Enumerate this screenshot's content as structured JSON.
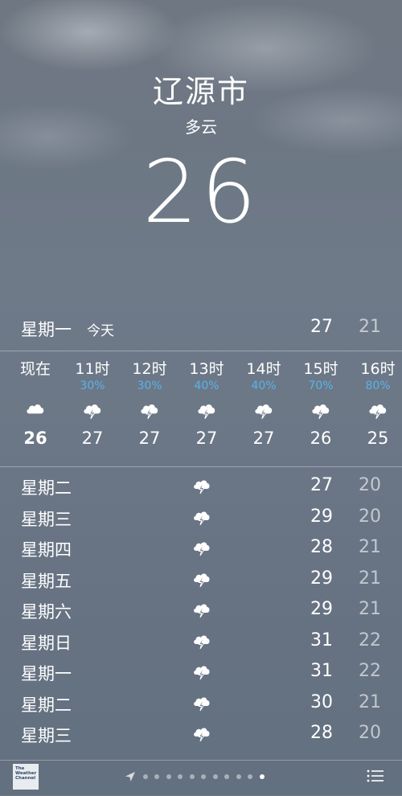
{
  "header": {
    "city": "辽源市",
    "condition": "多云",
    "temperature": "26"
  },
  "today": {
    "day": "星期一",
    "tag": "今天",
    "high": "27",
    "low": "21"
  },
  "hourly": [
    {
      "label": "现在",
      "pop": "",
      "icon": "cloud-icon",
      "temp": "26"
    },
    {
      "label": "11时",
      "pop": "30%",
      "icon": "thunderstorm-icon",
      "temp": "27"
    },
    {
      "label": "12时",
      "pop": "30%",
      "icon": "thunderstorm-icon",
      "temp": "27"
    },
    {
      "label": "13时",
      "pop": "40%",
      "icon": "thunderstorm-icon",
      "temp": "27"
    },
    {
      "label": "14时",
      "pop": "40%",
      "icon": "thunderstorm-icon",
      "temp": "27"
    },
    {
      "label": "15时",
      "pop": "70%",
      "icon": "thunderstorm-icon",
      "temp": "26"
    },
    {
      "label": "16时",
      "pop": "80%",
      "icon": "thunderstorm-icon",
      "temp": "25"
    }
  ],
  "daily": [
    {
      "day": "星期二",
      "icon": "thunderstorm-icon",
      "high": "27",
      "low": "20"
    },
    {
      "day": "星期三",
      "icon": "thunderstorm-icon",
      "high": "29",
      "low": "20"
    },
    {
      "day": "星期四",
      "icon": "thunderstorm-icon",
      "high": "28",
      "low": "21"
    },
    {
      "day": "星期五",
      "icon": "thunderstorm-icon",
      "high": "29",
      "low": "21"
    },
    {
      "day": "星期六",
      "icon": "thunderstorm-icon",
      "high": "29",
      "low": "21"
    },
    {
      "day": "星期日",
      "icon": "thunderstorm-icon",
      "high": "31",
      "low": "22"
    },
    {
      "day": "星期一",
      "icon": "thunderstorm-icon",
      "high": "31",
      "low": "22"
    },
    {
      "day": "星期二",
      "icon": "thunderstorm-icon",
      "high": "30",
      "low": "21"
    },
    {
      "day": "星期三",
      "icon": "thunderstorm-icon",
      "high": "28",
      "low": "20"
    }
  ],
  "footer": {
    "brand_lines": [
      "The",
      "Weather",
      "Channel"
    ],
    "page_count": 11,
    "active_page": 11,
    "colors": {
      "precip": "#5ab2ea"
    }
  }
}
